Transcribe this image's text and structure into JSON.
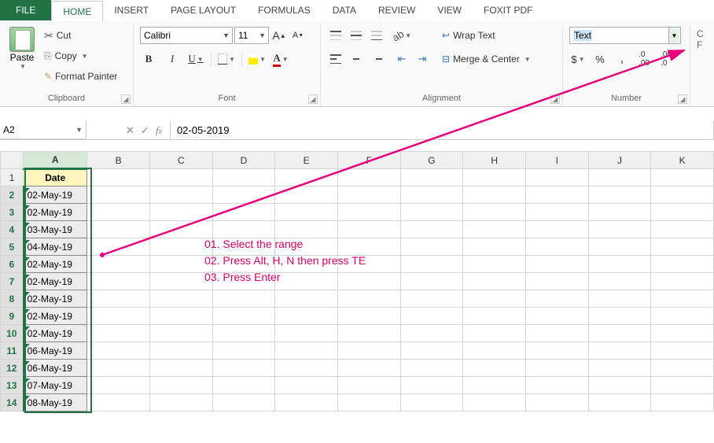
{
  "tabs": {
    "file": "FILE",
    "home": "HOME",
    "insert": "INSERT",
    "page_layout": "PAGE LAYOUT",
    "formulas": "FORMULAS",
    "data": "DATA",
    "review": "REVIEW",
    "view": "VIEW",
    "foxit": "FOXIT PDF"
  },
  "ribbon": {
    "clipboard": {
      "paste": "Paste",
      "cut": "Cut",
      "copy": "Copy",
      "format_painter": "Format Painter",
      "label": "Clipboard"
    },
    "font": {
      "name": "Calibri",
      "size": "11",
      "label": "Font"
    },
    "alignment": {
      "wrap_text": "Wrap Text",
      "merge_center": "Merge & Center",
      "label": "Alignment"
    },
    "number": {
      "format": "Text",
      "label": "Number"
    }
  },
  "formula_bar": {
    "name_box": "A2",
    "formula": "02-05-2019"
  },
  "columns": [
    "A",
    "B",
    "C",
    "D",
    "E",
    "F",
    "G",
    "H",
    "I",
    "J",
    "K"
  ],
  "rows": [
    {
      "num": "1",
      "val": "Date",
      "header": true
    },
    {
      "num": "2",
      "val": "02-May-19"
    },
    {
      "num": "3",
      "val": "02-May-19"
    },
    {
      "num": "4",
      "val": "03-May-19"
    },
    {
      "num": "5",
      "val": "04-May-19"
    },
    {
      "num": "6",
      "val": "02-May-19"
    },
    {
      "num": "7",
      "val": "02-May-19"
    },
    {
      "num": "8",
      "val": "02-May-19"
    },
    {
      "num": "9",
      "val": "02-May-19"
    },
    {
      "num": "10",
      "val": "02-May-19"
    },
    {
      "num": "11",
      "val": "06-May-19"
    },
    {
      "num": "12",
      "val": "06-May-19"
    },
    {
      "num": "13",
      "val": "07-May-19"
    },
    {
      "num": "14",
      "val": "08-May-19"
    }
  ],
  "annotation": {
    "line1": "01. Select the range",
    "line2": "02. Press Alt, H, N then press TE",
    "line3": "03. Press Enter"
  }
}
